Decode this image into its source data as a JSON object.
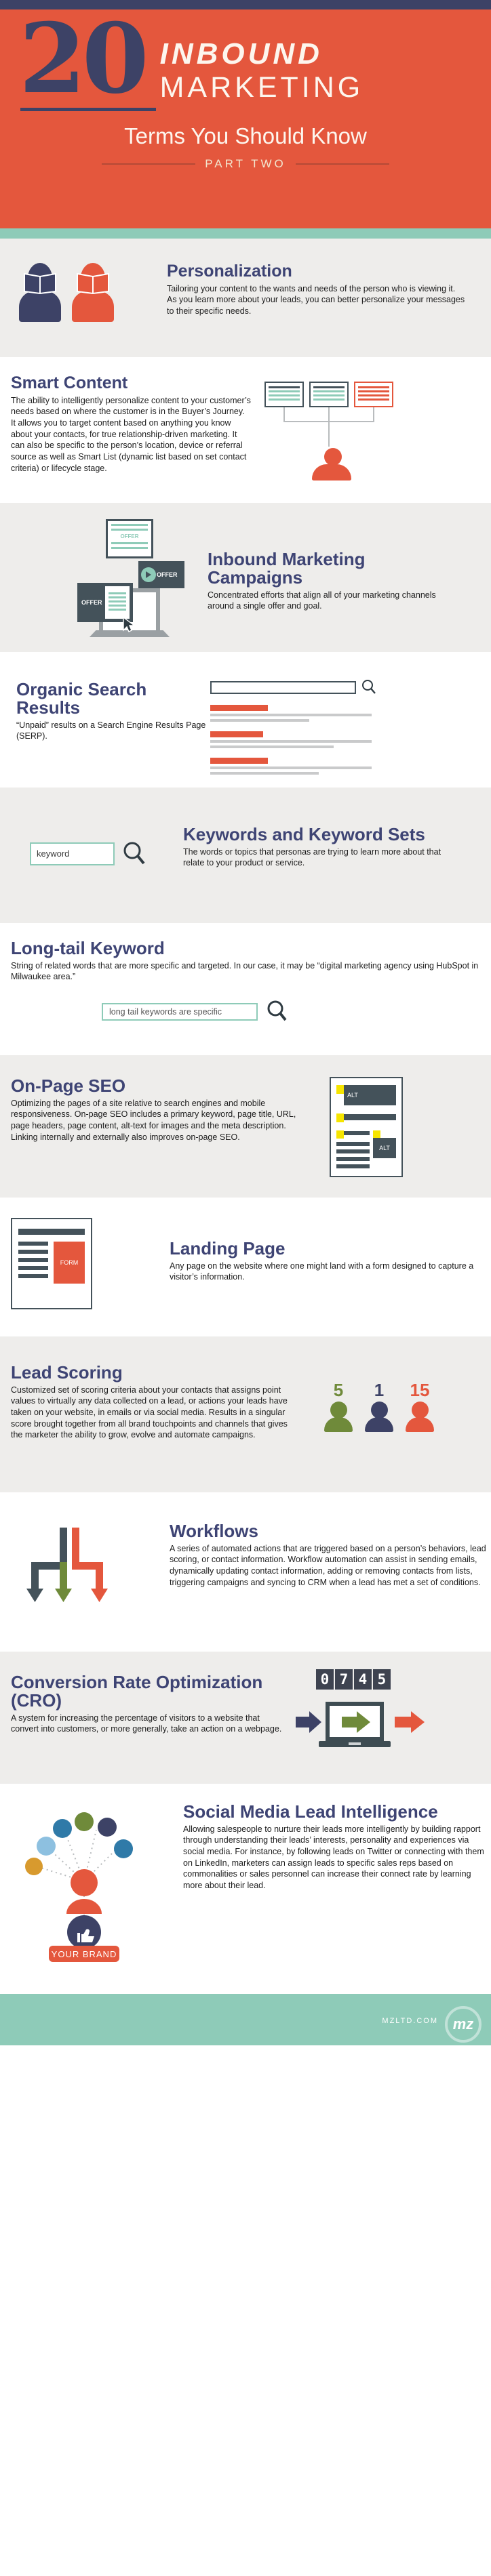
{
  "header": {
    "number": "20",
    "inbound": "INBOUND",
    "marketing": "MARKETING",
    "subtitle": "Terms You Should Know",
    "part": "PART TWO"
  },
  "colors": {
    "orange": "#e4573d",
    "navy": "#3d4266",
    "teal": "#8ecbb8",
    "slate": "#44525a",
    "olive": "#6f8a3a",
    "yellow": "#f6e500",
    "grey_bg": "#eeedeb"
  },
  "sections": [
    {
      "id": "personalization",
      "title": "Personalization",
      "body": "Tailoring your content to the wants and needs of the person who is viewing it. As you learn more about your leads, you can better personalize your messages to their specific needs."
    },
    {
      "id": "smart-content",
      "title": "Smart Content",
      "body": "The ability to intelligently personalize content to your customer’s needs based on where the customer is in the Buyer’s Journey. It allows you to target content based on anything you know about your contacts, for true relationship-driven marketing. It can also be specific to the person’s location, device or referral source as well as Smart List (dynamic list based on set contact criteria) or lifecycle stage."
    },
    {
      "id": "inbound-marketing-campaigns",
      "title": "Inbound Marketing Campaigns",
      "body": "Concentrated efforts that align all of your marketing channels around a single offer and goal.",
      "art_labels": {
        "offer1": "OFFER",
        "offer2": "OFFER",
        "offer3": "OFFER"
      }
    },
    {
      "id": "organic-search-results",
      "title": "Organic Search Results",
      "body": "“Unpaid” results on a Search Engine Results Page (SERP)."
    },
    {
      "id": "keywords-and-keyword-sets",
      "title": "Keywords and Keyword Sets",
      "body": "The words or topics that personas are trying to learn more about that relate to your product or service.",
      "input_value": "keyword"
    },
    {
      "id": "long-tail-keyword",
      "title": "Long-tail Keyword",
      "body": "String of related words that are more specific and targeted. In our case, it may be “digital marketing agency using HubSpot in Milwaukee area.”",
      "input_value": "long tail keywords are specific"
    },
    {
      "id": "on-page-seo",
      "title": "On-Page SEO",
      "body": "Optimizing the pages of a site relative to search engines and mobile responsiveness. On-page SEO includes a primary keyword, page title, URL, page headers, page content, alt-text for images and the meta description. Linking internally and externally also improves on-page SEO.",
      "art_labels": {
        "alt1": "ALT",
        "alt2": "ALT"
      }
    },
    {
      "id": "landing-page",
      "title": "Landing Page",
      "body": "Any page on the website where one might land with a form designed to capture a visitor’s information.",
      "art_labels": {
        "form": "FORM"
      }
    },
    {
      "id": "lead-scoring",
      "title": "Lead Scoring",
      "body": "Customized set of scoring criteria about your contacts that assigns point values to virtually any data collected on a lead, or actions your leads have taken on your website, in emails or via social media. Results in a singular score brought together from all brand touchpoints and channels that gives the marketer the ability to grow, evolve and automate campaigns.",
      "scores": [
        {
          "value": "5",
          "color": "#6f8a3a"
        },
        {
          "value": "1",
          "color": "#3d4266"
        },
        {
          "value": "15",
          "color": "#e4573d"
        }
      ]
    },
    {
      "id": "workflows",
      "title": "Workflows",
      "body": "A series of automated actions that are triggered based on a person’s behaviors, lead scoring, or contact information. Workflow automation can assist in sending emails, dynamically updating contact information, adding or removing contacts from lists, triggering campaigns and syncing to CRM when a lead has met a set of conditions."
    },
    {
      "id": "conversion-rate-optimization",
      "title": "Conversion Rate Optimization (CRO)",
      "body": "A system for increasing the percentage of visitors to a website that convert into customers, or more generally, take an action on a webpage.",
      "odometer": [
        "0",
        "7",
        "4",
        "5"
      ]
    },
    {
      "id": "social-media-lead-intelligence",
      "title": "Social Media Lead Intelligence",
      "body": "Allowing salespeople to nurture their leads more intelligently by building rapport through understanding their leads’ interests, personality and experiences via social media. For instance, by following leads on Twitter or connecting with them on LinkedIn, marketers can assign leads to specific sales reps based on commonalities or sales personnel can increase their connect rate by learning more about their lead.",
      "brand_label": "YOUR BRAND"
    }
  ],
  "footer": {
    "url": "MZLTD.COM",
    "logo": "mz"
  }
}
